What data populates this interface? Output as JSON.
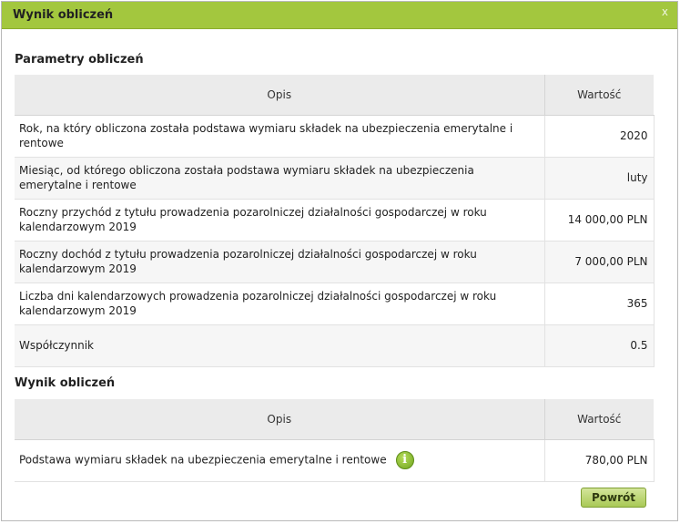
{
  "dialog": {
    "title": "Wynik obliczeń",
    "close_label": "x"
  },
  "params": {
    "section_title": "Parametry obliczeń",
    "headers": {
      "desc": "Opis",
      "value": "Wartość"
    },
    "rows": [
      {
        "desc": "Rok, na który obliczona została podstawa wymiaru składek na ubezpieczenia emerytalne i rentowe",
        "value": "2020"
      },
      {
        "desc": "Miesiąc, od którego obliczona została podstawa wymiaru składek na ubezpieczenia emerytalne i rentowe",
        "value": "luty"
      },
      {
        "desc": "Roczny przychód z tytułu prowadzenia pozarolniczej działalności gospodarczej w roku kalendarzowym 2019",
        "value": "14 000,00 PLN"
      },
      {
        "desc": "Roczny dochód z tytułu prowadzenia pozarolniczej działalności gospodarczej w roku kalendarzowym 2019",
        "value": "7 000,00 PLN"
      },
      {
        "desc": "Liczba dni kalendarzowych prowadzenia pozarolniczej działalności gospodarczej w roku kalendarzowym 2019",
        "value": "365"
      },
      {
        "desc": "Współczynnik",
        "value": "0.5"
      }
    ]
  },
  "result": {
    "section_title": "Wynik obliczeń",
    "headers": {
      "desc": "Opis",
      "value": "Wartość"
    },
    "rows": [
      {
        "desc": "Podstawa wymiaru składek na ubezpieczenia emerytalne i rentowe",
        "value": "780,00 PLN",
        "icon": "info-icon"
      }
    ]
  },
  "footer": {
    "back_label": "Powrót"
  },
  "colors": {
    "titlebar": "#a3c73e",
    "header_bg": "#ebebeb",
    "button": "#b9d46a"
  }
}
